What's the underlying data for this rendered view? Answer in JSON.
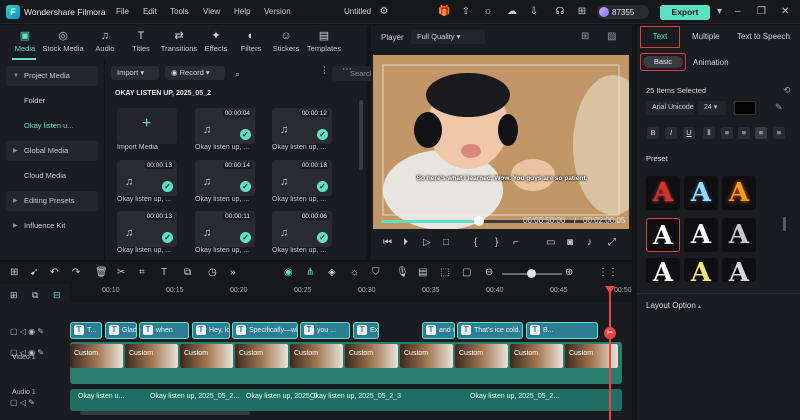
{
  "titlebar": {
    "logo_letter": "F",
    "app_name": "Wondershare Filmora",
    "menus": [
      "File",
      "Edit",
      "Tools",
      "View",
      "Help",
      "Version"
    ],
    "doc_title": "Untitled",
    "points": "87355",
    "export_label": "Export"
  },
  "media_tabs": [
    {
      "label": "Media",
      "icon": "media-icon"
    },
    {
      "label": "Stock Media",
      "icon": "stock-media-icon"
    },
    {
      "label": "Audio",
      "icon": "audio-icon"
    },
    {
      "label": "Titles",
      "icon": "titles-icon"
    },
    {
      "label": "Transitions",
      "icon": "transitions-icon"
    },
    {
      "label": "Effects",
      "icon": "effects-icon"
    },
    {
      "label": "Filters",
      "icon": "filters-icon"
    },
    {
      "label": "Stickers",
      "icon": "stickers-icon"
    },
    {
      "label": "Templates",
      "icon": "templates-icon"
    }
  ],
  "side_nav": [
    "Project Media",
    "Folder",
    "Okay listen u...",
    "Global Media",
    "Cloud Media",
    "Editing Presets",
    "Influence Kit"
  ],
  "media": {
    "import_label": "Import",
    "record_label": "Record",
    "search_placeholder": "Search media",
    "folder_title": "OKAY LISTEN UP, 2025_05_2",
    "import_media_label": "Import Media",
    "thumbs": [
      {
        "dur": "00:00:04",
        "name": "Okay listen up, ..."
      },
      {
        "dur": "00:00:12",
        "name": "Okay listen up, ..."
      },
      {
        "dur": "00:00:13",
        "name": "Okay listen up, ..."
      },
      {
        "dur": "00:00:14",
        "name": "Okay listen up, ..."
      },
      {
        "dur": "00:00:18",
        "name": "Okay listen up, ..."
      },
      {
        "dur": "00:00:13",
        "name": "Okay listen up, ..."
      },
      {
        "dur": "00:00:11",
        "name": "Okay listen up, ..."
      },
      {
        "dur": "00:00:06",
        "name": "Okay listen up, ..."
      }
    ]
  },
  "player": {
    "label": "Player",
    "quality": "Full Quality",
    "subtitle": "So here's what I learned. Wow. You guys are so patient.",
    "current_time": "00:00:50:00",
    "separator": "/",
    "total_time": "00:02:00:05",
    "progress": 0.42
  },
  "right_panel": {
    "tabs": [
      "Text",
      "Multiple",
      "Text to Speech"
    ],
    "subtabs": [
      "Basic",
      "Animation"
    ],
    "items_selected": "25 Items Selected",
    "font": "Arial Unicode",
    "size": "24",
    "preset_label": "Preset",
    "preset_glyph": "A",
    "layout_option": "Layout Option"
  },
  "timeline": {
    "ruler_ticks": [
      "00:10",
      "00:15",
      "00:20",
      "00:25",
      "00:30",
      "00:35",
      "00:40",
      "00:45",
      "00:50"
    ],
    "text_clips": [
      "T...",
      "Glad to...",
      "when",
      "Hey, love wait...",
      "Specifically—wh...",
      "you ...",
      "Exa...",
      "and walked ...",
      "That's ice cold.",
      "B..."
    ],
    "video_label": "Video 1",
    "audio_label": "Audio 1",
    "video_clip_name": "Custom",
    "audio_clip_names": [
      "Okay listen u...",
      "Okay listen up, 2025_05_2...",
      "Okay listen up, 2025_0...",
      "Okay listen up, 2025_05_2_3",
      "Okay listen up, 2025_05_2..."
    ]
  },
  "colors": {
    "accent": "#5fe0c4",
    "highlight_border": "#e03c3c",
    "playhead": "#e84545"
  }
}
